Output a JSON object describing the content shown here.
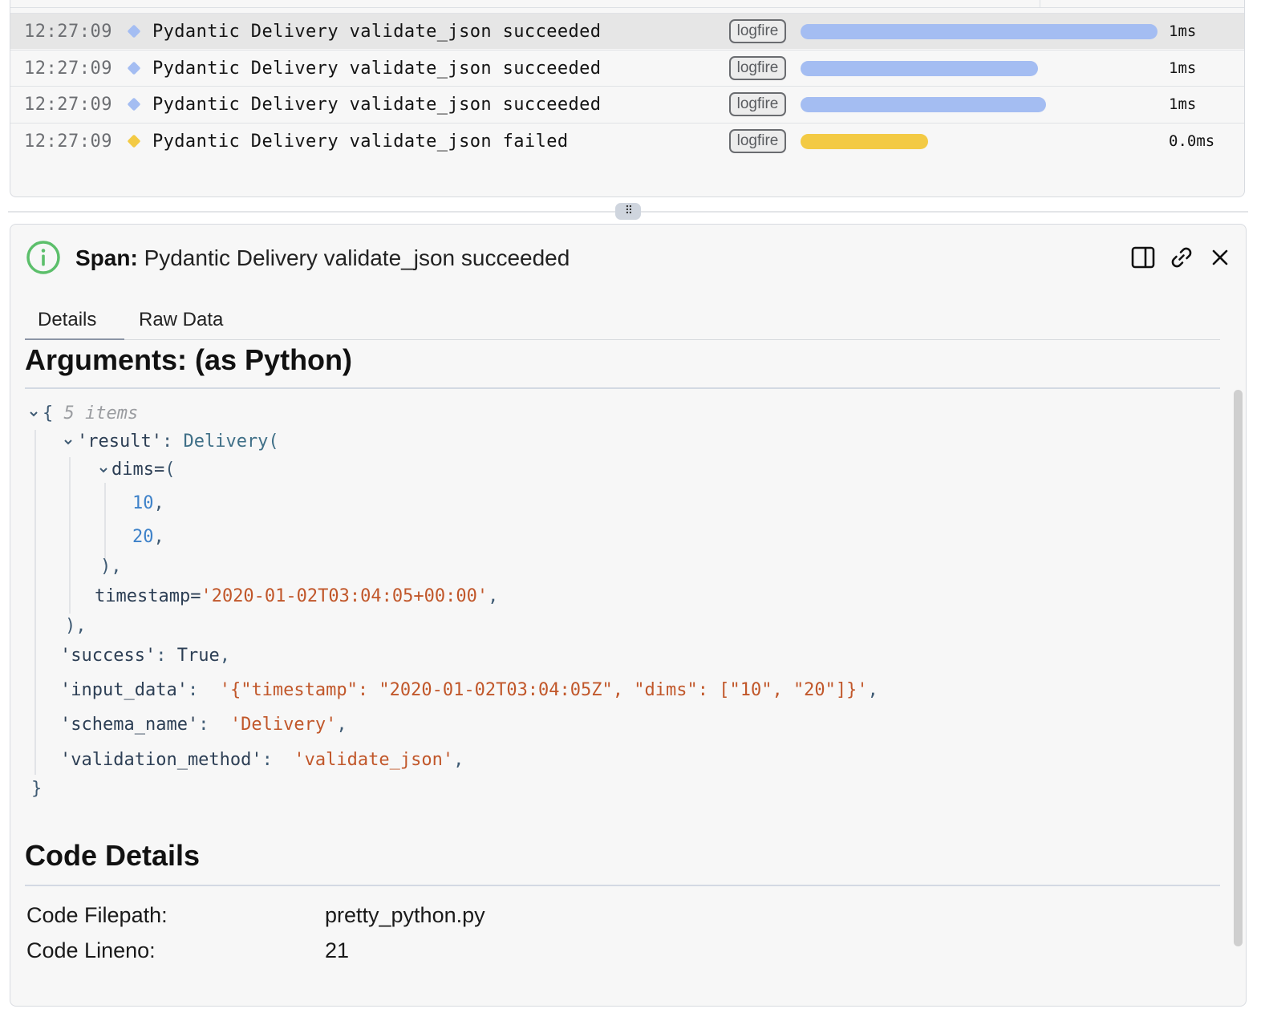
{
  "trace_rows": [
    {
      "time": "12:27:09",
      "message": "Pydantic Delivery validate_json succeeded",
      "tag": "logfire",
      "duration": "1ms",
      "status_color": "#a4bdf2",
      "bar_color": "#a4bdf2",
      "selected": true
    },
    {
      "time": "12:27:09",
      "message": "Pydantic Delivery validate_json succeeded",
      "tag": "logfire",
      "duration": "1ms",
      "status_color": "#a4bdf2",
      "bar_color": "#a4bdf2",
      "selected": false
    },
    {
      "time": "12:27:09",
      "message": "Pydantic Delivery validate_json succeeded",
      "tag": "logfire",
      "duration": "1ms",
      "status_color": "#a4bdf2",
      "bar_color": "#a4bdf2",
      "selected": false
    },
    {
      "time": "12:27:09",
      "message": "Pydantic Delivery validate_json failed",
      "tag": "logfire",
      "duration": "0.0ms",
      "status_color": "#f3ca44",
      "bar_color": "#f3ca44",
      "selected": false
    }
  ],
  "splitter": {
    "grip": "⠿"
  },
  "detail": {
    "label": "Span:",
    "title": "Pydantic Delivery validate_json succeeded",
    "status_icon": "info-circle-icon",
    "actions": [
      "split-view-icon",
      "link-icon",
      "close-icon"
    ],
    "tabs": [
      {
        "label": "Details",
        "active": true
      },
      {
        "label": "Raw Data",
        "active": false
      }
    ],
    "arguments_heading": "Arguments: (as Python)",
    "arguments": {
      "open_brace": "{",
      "count": "5 items",
      "result_key": "'result'",
      "colon": ":",
      "result_class": "Delivery(",
      "dims_key": "dims=",
      "dims_open": "(",
      "dims_values": [
        "10",
        "20"
      ],
      "comma": ",",
      "dims_close": "),",
      "timestamp_key": "timestamp=",
      "timestamp_value": "'2020-01-02T03:04:05+00:00'",
      "result_close": "),",
      "success_key": "'success'",
      "success_value": "True",
      "input_data_key": "'input_data'",
      "input_data_value": "'{\"timestamp\": \"2020-01-02T03:04:05Z\", \"dims\": [\"10\", \"20\"]}'",
      "schema_name_key": "'schema_name'",
      "schema_name_value": "'Delivery'",
      "validation_method_key": "'validation_method'",
      "validation_method_value": "'validate_json'",
      "close_brace": "}"
    },
    "code_heading": "Code Details",
    "code_details": [
      {
        "label": "Code Filepath:",
        "value": "pretty_python.py"
      },
      {
        "label": "Code Lineno:",
        "value": "21"
      }
    ]
  },
  "colors": {
    "accent_blue": "#a4bdf2",
    "warning_yellow": "#f3ca44",
    "success_green": "#5cbf6b",
    "string_orange": "#c1572a",
    "number_blue": "#3e82c9"
  }
}
